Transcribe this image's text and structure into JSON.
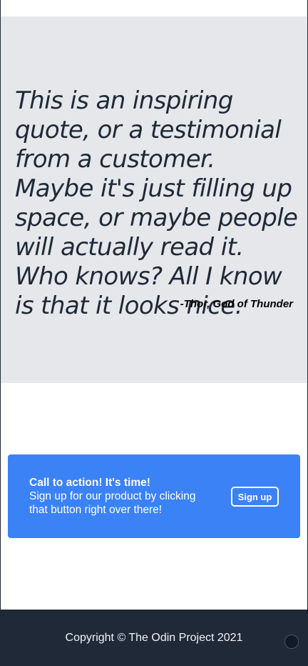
{
  "quote": {
    "text": "This is an inspiring quote, or a testimonial from a customer. Maybe it's just filling up space, or maybe people will actually read it. Who knows? All I know is that it looks nice.",
    "author": "-Thor, God of Thunder"
  },
  "cta": {
    "title": "Call to action! It's time!",
    "description": "Sign up for our product by clicking that button right over there!",
    "button_label": "Sign up"
  },
  "footer": {
    "copyright": "Copyright © The Odin Project 2021"
  },
  "colors": {
    "quote_background": "#e5e7eb",
    "cta_background": "#3b82f6",
    "footer_background": "#1f2937",
    "text_dark": "#1f2937"
  }
}
